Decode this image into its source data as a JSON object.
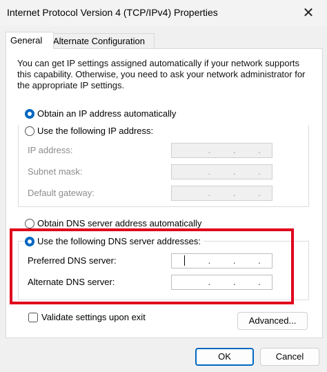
{
  "window": {
    "title": "Internet Protocol Version 4 (TCP/IPv4) Properties",
    "close_glyph": "✕"
  },
  "tabs": [
    {
      "label": "General",
      "active": true
    },
    {
      "label": "Alternate Configuration",
      "active": false
    }
  ],
  "info_text": "You can get IP settings assigned automatically if your network supports this capability. Otherwise, you need to ask your network administrator for the appropriate IP settings.",
  "ip_section": {
    "auto_label": "Obtain an IP address automatically",
    "auto_selected": true,
    "manual_label": "Use the following IP address:",
    "manual_selected": false,
    "fields": [
      {
        "label": "IP address:",
        "value": ""
      },
      {
        "label": "Subnet mask:",
        "value": ""
      },
      {
        "label": "Default gateway:",
        "value": ""
      }
    ]
  },
  "dns_section": {
    "auto_label": "Obtain DNS server address automatically",
    "auto_selected": false,
    "manual_label": "Use the following DNS server addresses:",
    "manual_selected": true,
    "preferred_label": "Preferred DNS server:",
    "alternate_label": "Alternate DNS server:",
    "preferred_value": "",
    "alternate_value": ""
  },
  "ip_dot": ".",
  "validate_label": "Validate settings upon exit",
  "validate_checked": false,
  "buttons": {
    "advanced": "Advanced...",
    "ok": "OK",
    "cancel": "Cancel"
  },
  "colors": {
    "accent": "#0067c0",
    "highlight": "#e0001b"
  }
}
